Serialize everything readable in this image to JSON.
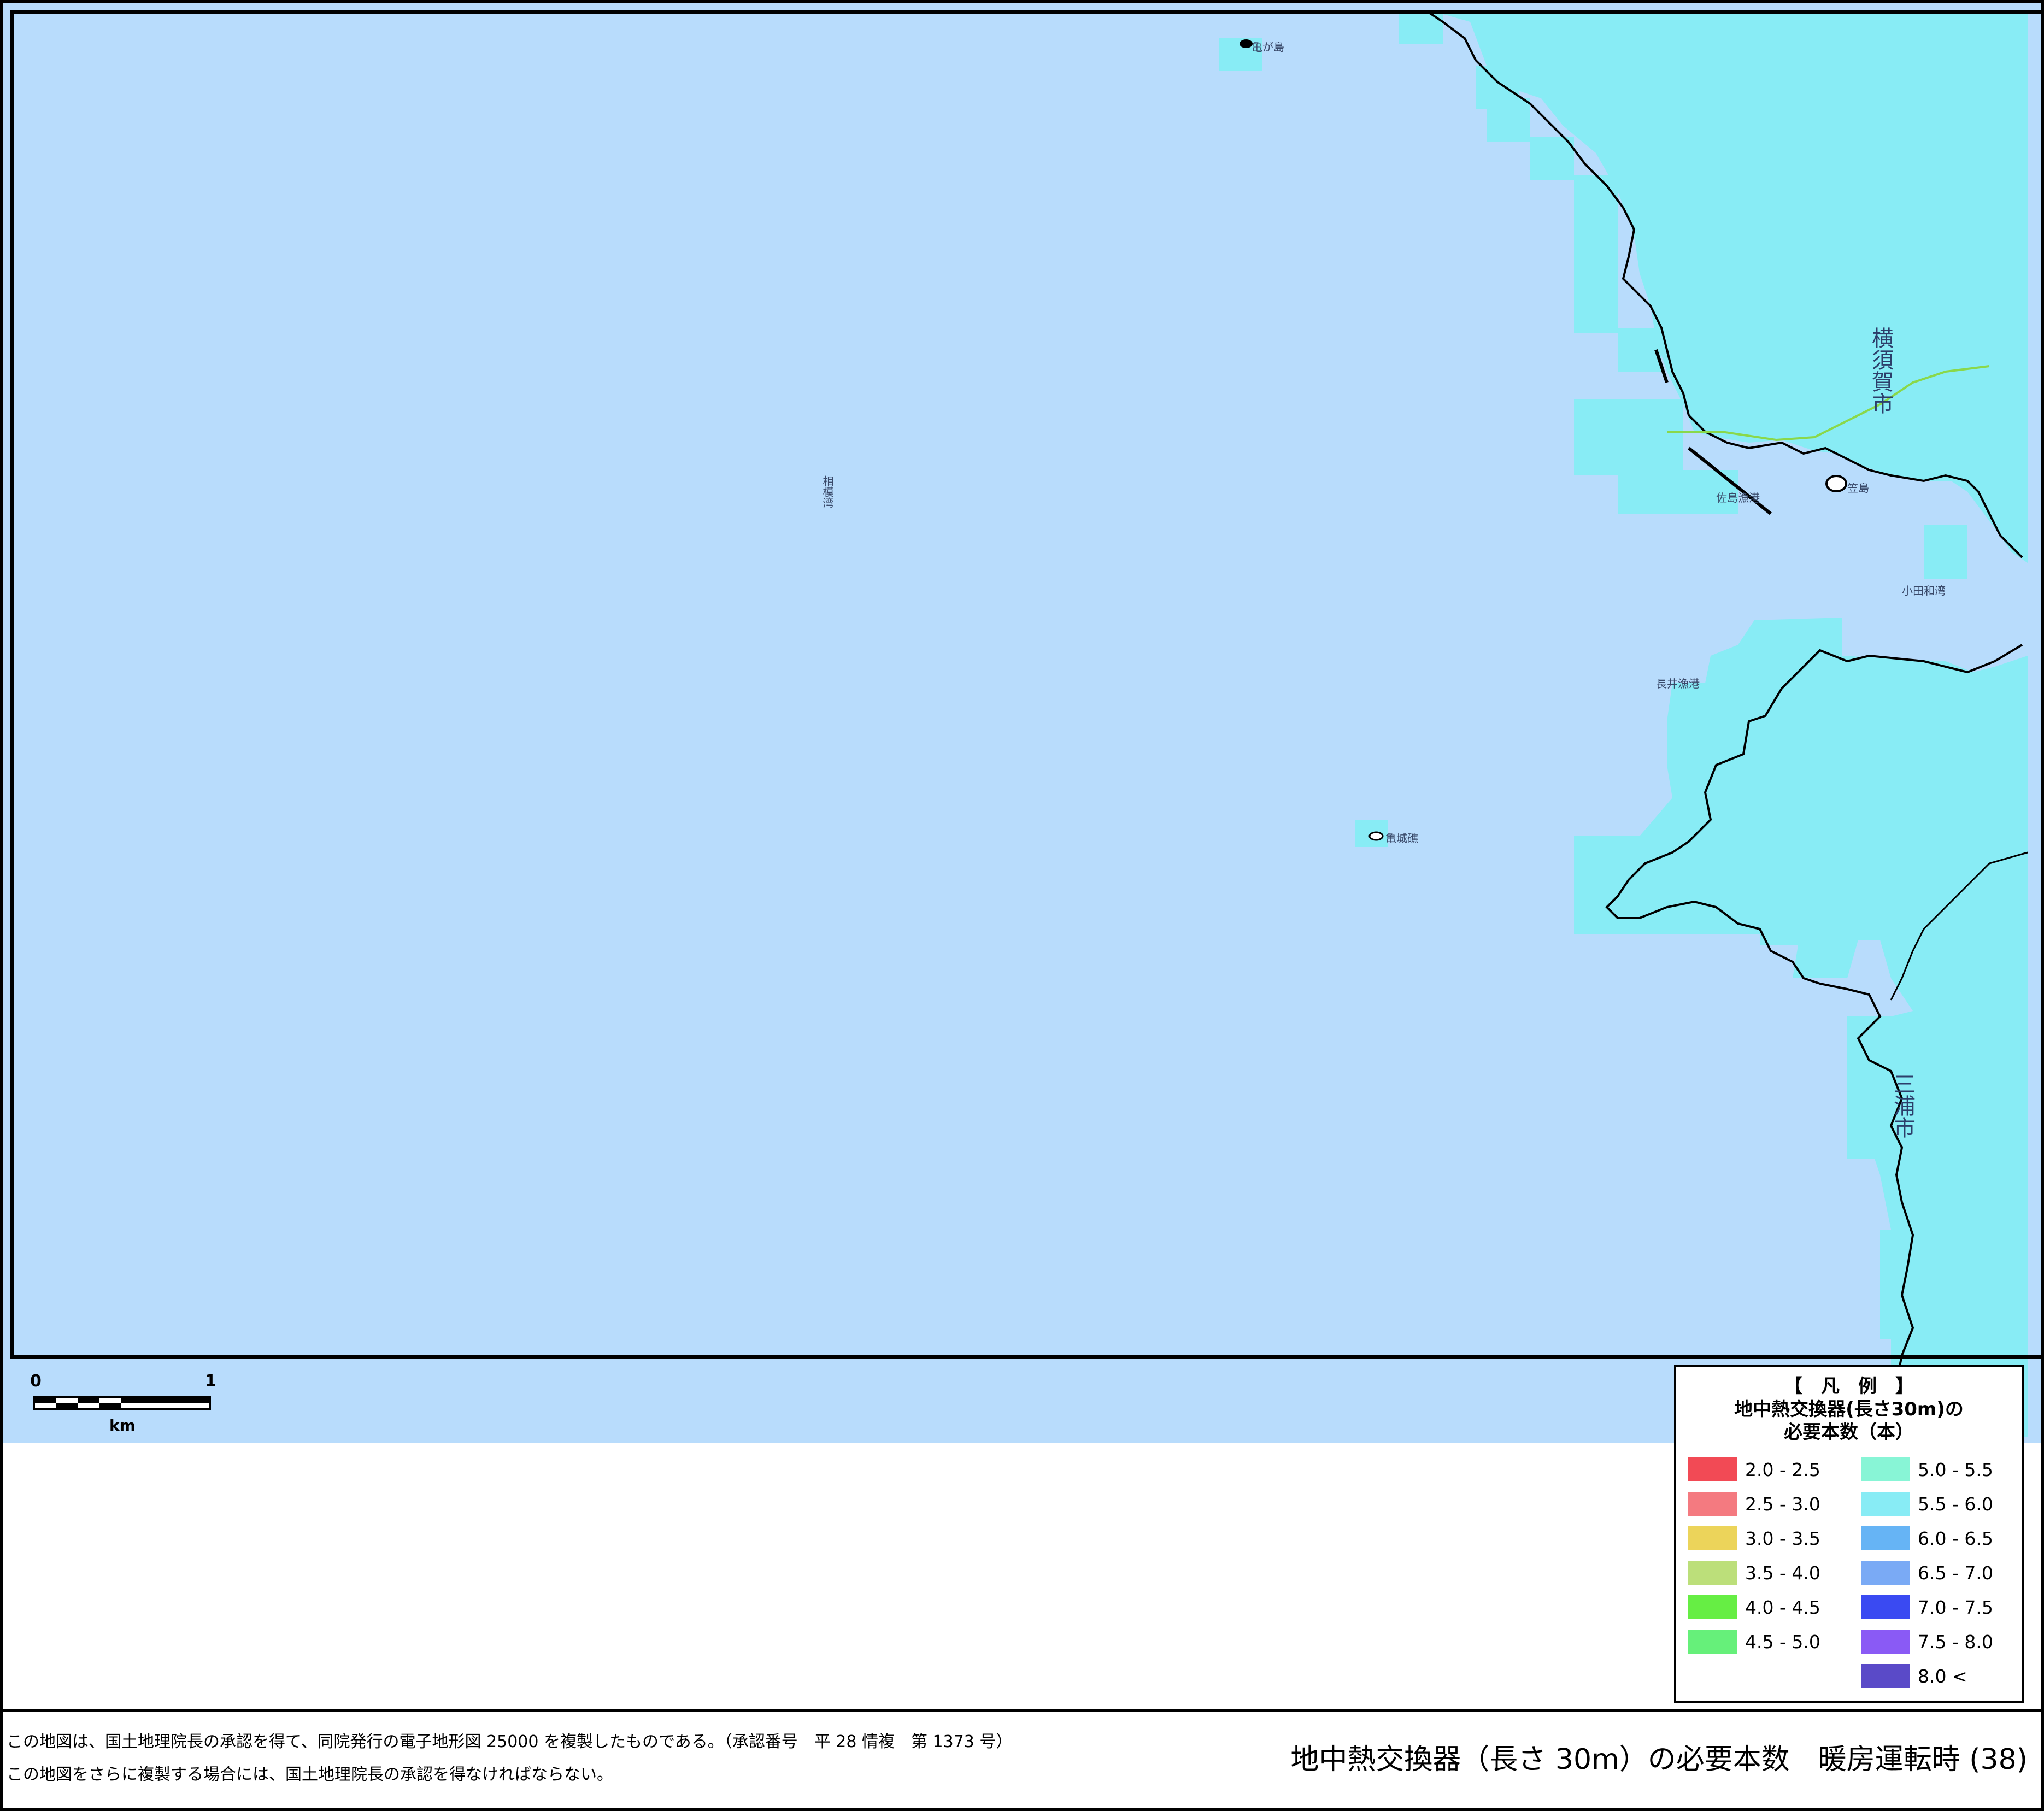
{
  "map": {
    "places": [
      {
        "id": "island-top",
        "name": "亀が島"
      },
      {
        "id": "bay-main",
        "name": "相模湾"
      },
      {
        "id": "port-1",
        "name": "佐島漁港"
      },
      {
        "id": "island-2",
        "name": "笠島"
      },
      {
        "id": "bay-2",
        "name": "小田和湾"
      },
      {
        "id": "port-2",
        "name": "長井漁港"
      },
      {
        "id": "reef",
        "name": "亀城礁"
      }
    ],
    "city_yokosuka": [
      "横",
      "須",
      "賀",
      "市"
    ],
    "city_miura": [
      "三",
      "浦",
      "市"
    ]
  },
  "scale": {
    "zero": "0",
    "one": "1",
    "unit": "km"
  },
  "legend": {
    "bracket_title": "【　凡　例　】",
    "subtitle_line1": "地中熱交換器(長さ30m)の",
    "subtitle_line2": "必要本数（本）",
    "items": [
      {
        "label": "2.0 - 2.5",
        "color": "#f24a55"
      },
      {
        "label": "2.5 - 3.0",
        "color": "#f47a80"
      },
      {
        "label": "3.0 - 3.5",
        "color": "#ecd45a"
      },
      {
        "label": "3.5 - 4.0",
        "color": "#bcdf7a"
      },
      {
        "label": "4.0 - 4.5",
        "color": "#66ee44"
      },
      {
        "label": "4.5 - 5.0",
        "color": "#66f07a"
      },
      {
        "label": "5.0 - 5.5",
        "color": "#88f5d6"
      },
      {
        "label": "5.5 - 6.0",
        "color": "#88ecf5"
      },
      {
        "label": "6.0 - 6.5",
        "color": "#66b4f5"
      },
      {
        "label": "6.5 - 7.0",
        "color": "#7aaaf5"
      },
      {
        "label": "7.0 - 7.5",
        "color": "#3a4af2"
      },
      {
        "label": "7.5 - 8.0",
        "color": "#8a5af5"
      },
      {
        "label": "8.0 <",
        "color": "#5a4ac8"
      }
    ]
  },
  "footer": {
    "credit_line1": "この地図は、国土地理院長の承認を得て、同院発行の電子地形図 25000 を複製したものである。（承認番号　平 28 情複　第 1373 号）",
    "credit_line2": "この地図をさらに複製する場合には、国土地理院長の承認を得なければならない。",
    "title": "地中熱交換器（長さ 30m）の必要本数　暖房運転時 (38)"
  },
  "colors": {
    "sea": "#b8dcfc",
    "land": "#88ecf5",
    "land_base": "#9be6e8"
  }
}
